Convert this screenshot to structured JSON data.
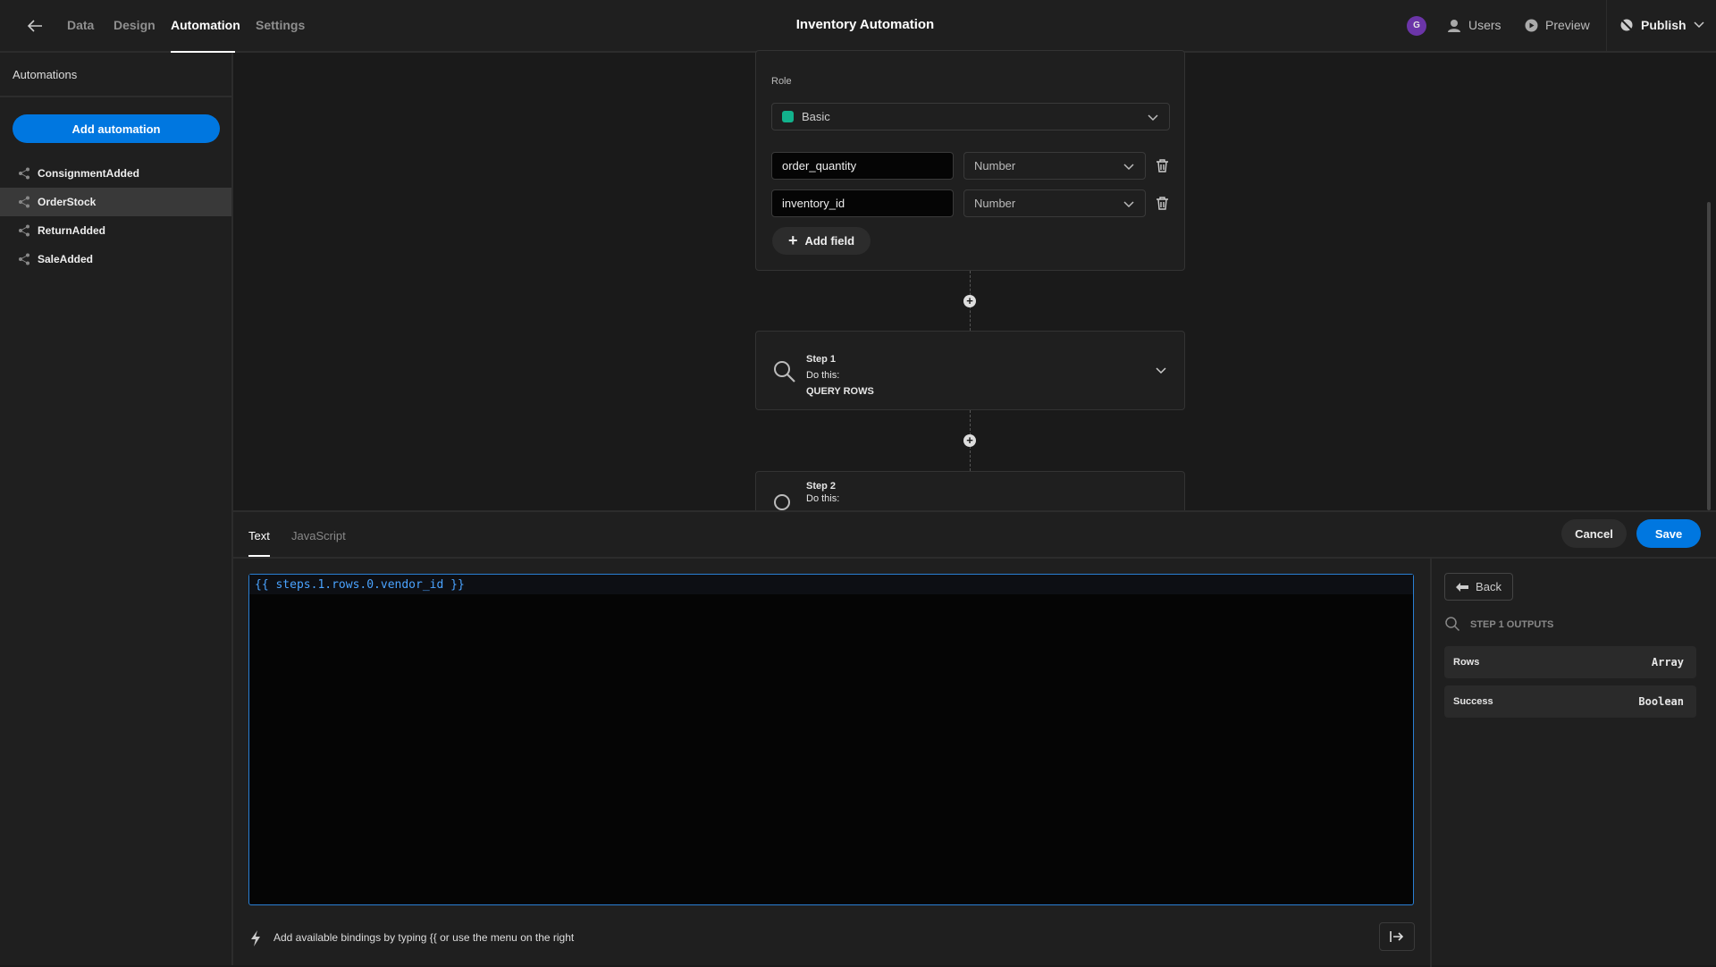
{
  "topbar": {
    "tabs": [
      "Data",
      "Design",
      "Automation",
      "Settings"
    ],
    "active_tab": "Automation",
    "title": "Inventory Automation",
    "avatar_initial": "G",
    "users": "Users",
    "preview": "Preview",
    "publish": "Publish"
  },
  "sidebar": {
    "heading": "Automations",
    "add_button": "Add automation",
    "items": [
      "ConsignmentAdded",
      "OrderStock",
      "ReturnAdded",
      "SaleAdded"
    ],
    "selected": "OrderStock"
  },
  "trigger_card": {
    "role_label": "Role",
    "role_value": "Basic",
    "role_color": "#12b28c",
    "fields": [
      {
        "name": "order_quantity",
        "type": "Number"
      },
      {
        "name": "inventory_id",
        "type": "Number"
      }
    ],
    "add_field": "Add field"
  },
  "steps": [
    {
      "label": "Step 1",
      "sub": "Do this:",
      "action": "QUERY ROWS"
    },
    {
      "label": "Step 2",
      "sub": "Do this:"
    }
  ],
  "editor": {
    "tabs": [
      "Text",
      "JavaScript"
    ],
    "active_tab": "Text",
    "cancel": "Cancel",
    "save": "Save",
    "value": "{{ steps.1.rows.0.vendor_id }}",
    "hint": "Add available bindings by typing {{ or use the menu on the right"
  },
  "bindings": {
    "back": "Back",
    "section": "STEP 1 OUTPUTS",
    "outputs": [
      {
        "name": "Rows",
        "type": "Array"
      },
      {
        "name": "Success",
        "type": "Boolean"
      }
    ]
  },
  "colors": {
    "accent": "#0077e0",
    "avatar": "#6b35a8",
    "code": "#4aa3ff"
  }
}
